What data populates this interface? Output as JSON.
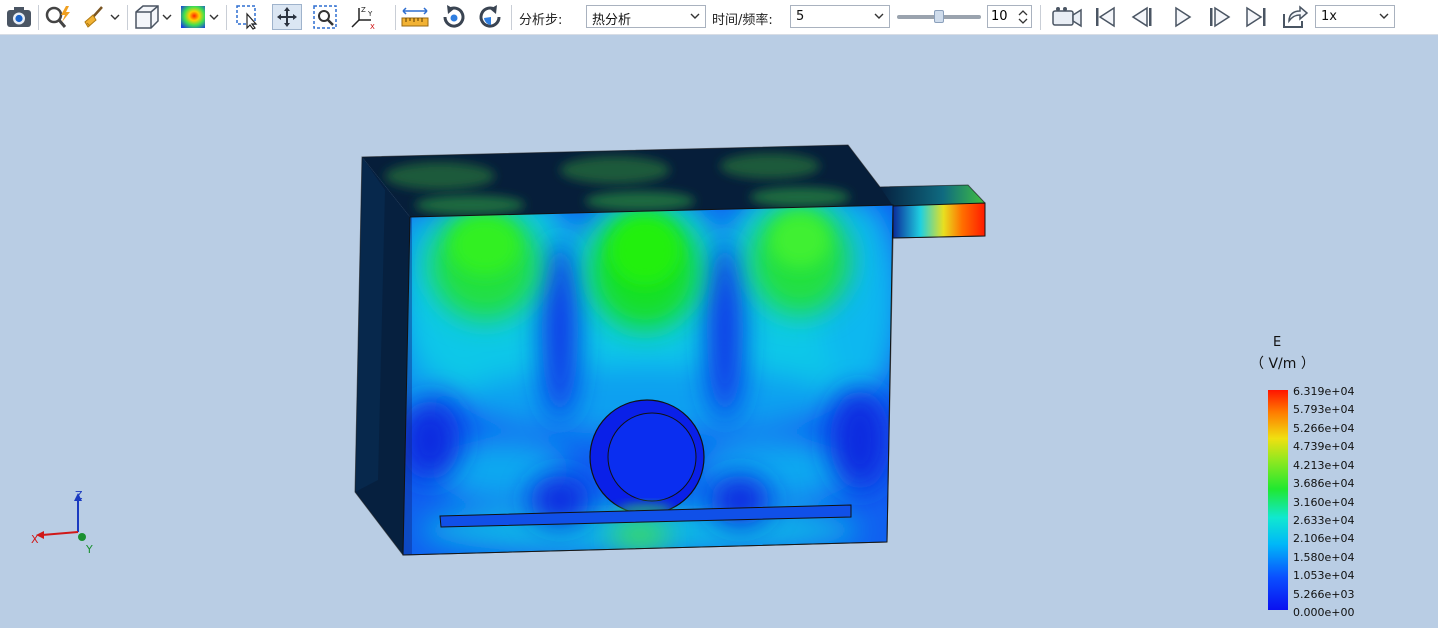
{
  "toolbar": {
    "analysis_step_label": "分析步:",
    "analysis_step_value": "热分析",
    "time_freq_label": "时间/频率:",
    "time_freq_value": "5",
    "slider_value": 0.5,
    "step_count": "10",
    "speed_value": "1x",
    "icons": [
      "camera-icon",
      "search-lightning-icon",
      "broom-icon",
      "cube-view-icon",
      "color-map-icon",
      "select-icon",
      "pan-icon",
      "zoom-box-icon",
      "axis-orient-icon",
      "ruler-icon",
      "rotate-cw-icon",
      "rotate-ccw-icon",
      "video-record-icon",
      "first-frame-icon",
      "prev-frame-icon",
      "play-icon",
      "next-frame-icon",
      "last-frame-icon",
      "export-icon"
    ]
  },
  "legend": {
    "quantity": "E",
    "unit": "（ V/m ）",
    "labels": [
      "6.319e+04",
      "5.793e+04",
      "5.266e+04",
      "4.739e+04",
      "4.213e+04",
      "3.686e+04",
      "3.160e+04",
      "2.633e+04",
      "2.106e+04",
      "1.580e+04",
      "1.053e+04",
      "5.266e+03",
      "0.000e+00"
    ]
  },
  "axes": {
    "z": "Z",
    "x": "X",
    "y": "Y"
  },
  "colors": {
    "background": "#b9cde4",
    "dark": "#06203f",
    "low": "#0a14e8",
    "high": "#ff1a00"
  }
}
